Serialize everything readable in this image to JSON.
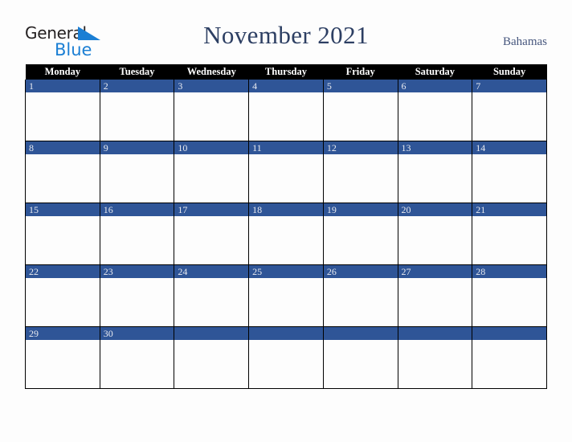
{
  "brand": {
    "name_part1": "General",
    "name_part2": "Blue",
    "triangle_icon": "blue-triangle-icon",
    "color_dark": "#231f20",
    "color_blue": "#1b7fd4"
  },
  "header": {
    "title": "November 2021",
    "country": "Bahamas",
    "title_color": "#2d3f63",
    "country_color": "#46567d"
  },
  "calendar": {
    "weekday_headers": [
      "Monday",
      "Tuesday",
      "Wednesday",
      "Thursday",
      "Friday",
      "Saturday",
      "Sunday"
    ],
    "header_bg": "#000000",
    "header_fg": "#ffffff",
    "daybar_bg": "#2f5597",
    "daybar_fg": "#e8eaf0",
    "cell_bg": "#fdfdfd",
    "grid_line": "#000000",
    "weeks": [
      [
        "1",
        "2",
        "3",
        "4",
        "5",
        "6",
        "7"
      ],
      [
        "8",
        "9",
        "10",
        "11",
        "12",
        "13",
        "14"
      ],
      [
        "15",
        "16",
        "17",
        "18",
        "19",
        "20",
        "21"
      ],
      [
        "22",
        "23",
        "24",
        "25",
        "26",
        "27",
        "28"
      ],
      [
        "29",
        "30",
        "",
        "",
        "",
        "",
        ""
      ]
    ]
  },
  "page": {
    "background": "#fdfdfd"
  }
}
